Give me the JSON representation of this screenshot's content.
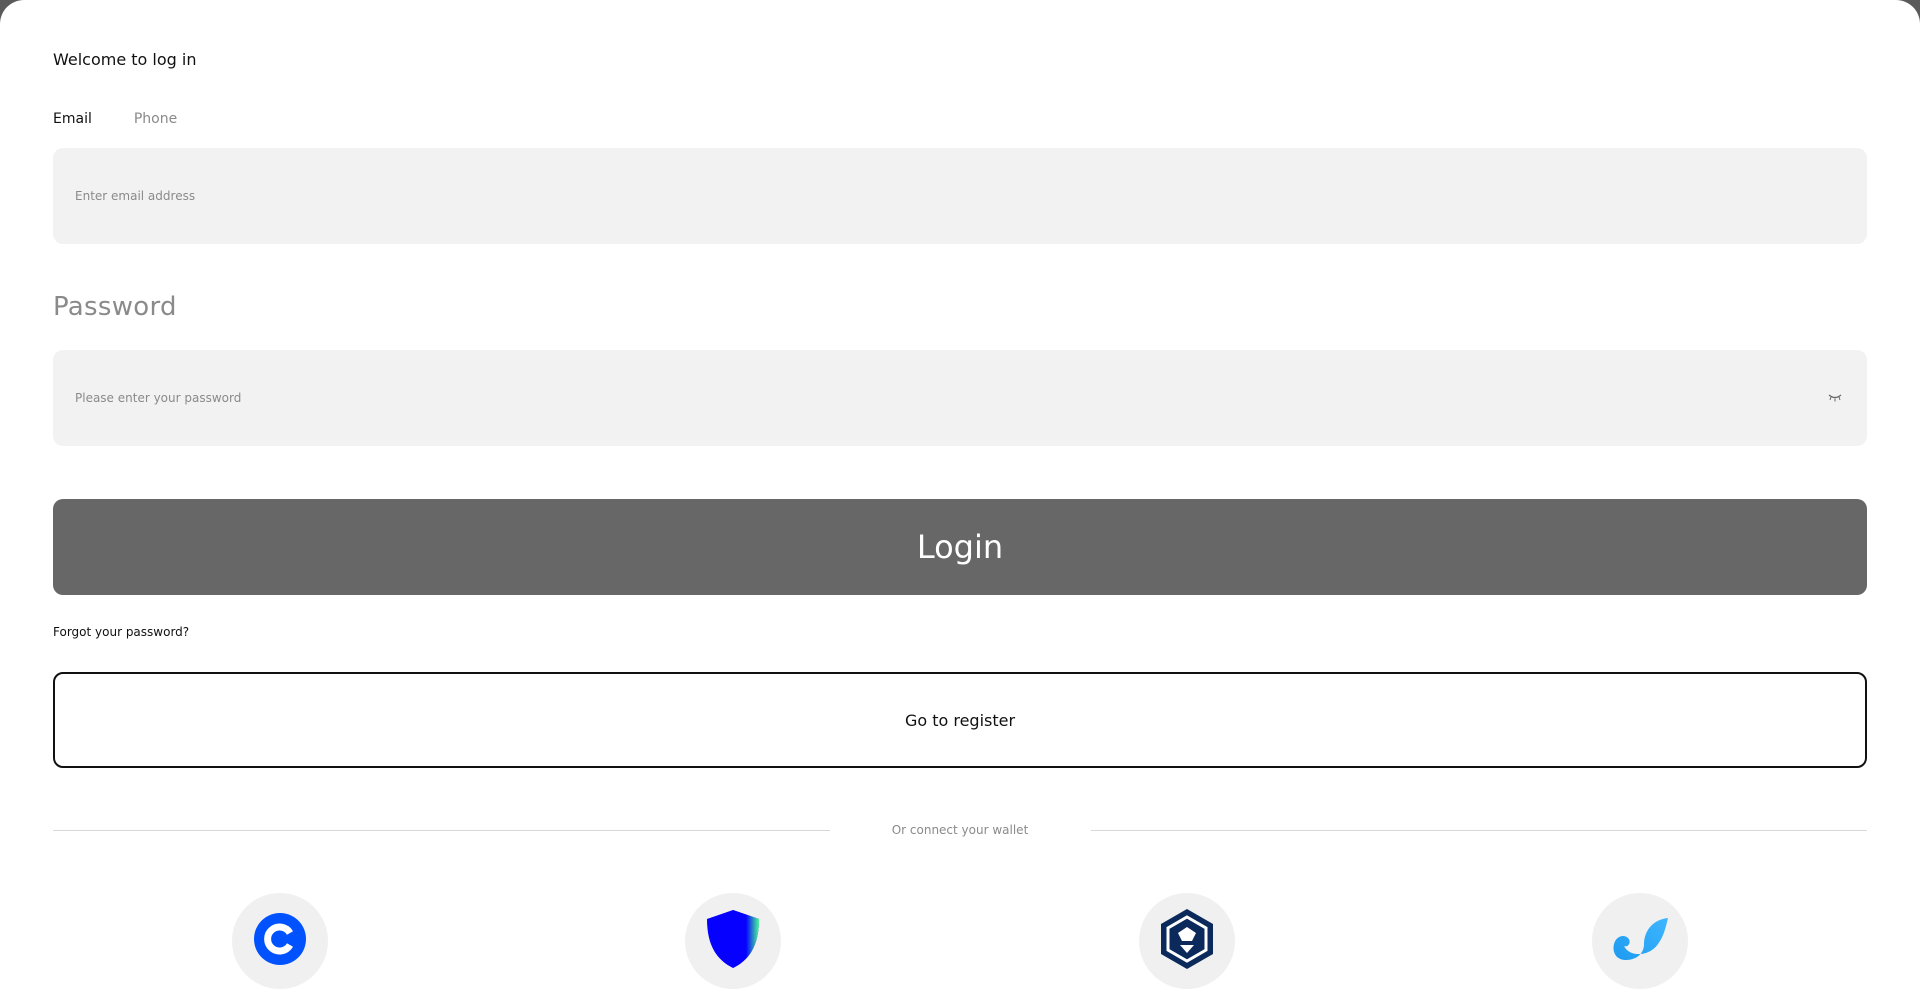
{
  "header": {
    "title": "Welcome to log in"
  },
  "tabs": [
    {
      "label": "Email",
      "active": true
    },
    {
      "label": "Phone",
      "active": false
    }
  ],
  "email": {
    "placeholder": "Enter email address",
    "value": ""
  },
  "password": {
    "label": "Password",
    "placeholder": "Please enter your password",
    "value": "",
    "toggle_icon": "eye-closed-icon"
  },
  "actions": {
    "login_label": "Login",
    "forgot_label": "Forgot your password?",
    "register_label": "Go to register"
  },
  "wallet_section": {
    "divider_text": "Or connect your wallet",
    "wallets": [
      {
        "icon": "coinbase-wallet-icon",
        "color": "#0052ff"
      },
      {
        "icon": "trust-wallet-icon",
        "color": "#0500ff"
      },
      {
        "icon": "crypto-com-icon",
        "color": "#0b2a5b"
      },
      {
        "icon": "wave-wallet-icon",
        "color": "#1e9bf0"
      }
    ]
  },
  "colors": {
    "login_button": "#676767",
    "field_background": "#f2f2f2",
    "muted_text": "#8a8a8a"
  }
}
